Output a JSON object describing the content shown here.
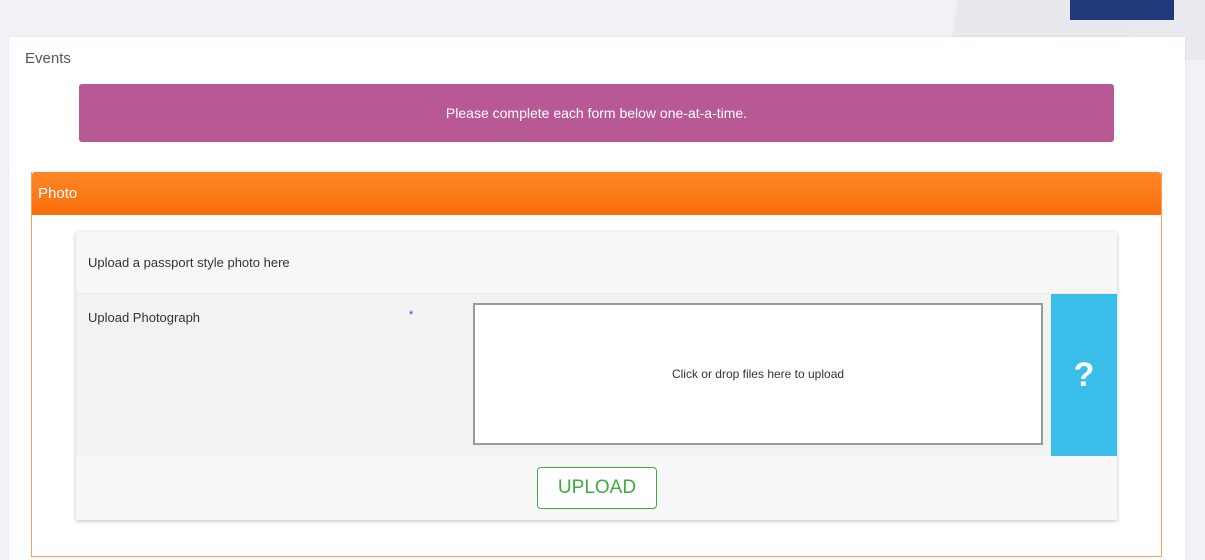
{
  "section": {
    "title": "Events"
  },
  "notice": {
    "text": "Please complete each form below one-at-a-time."
  },
  "panel": {
    "title": "Photo",
    "description": "Upload a passport style photo here",
    "field": {
      "label": "Upload Photograph",
      "required_marker": "*",
      "dropzone_text": "Click or drop files here to upload",
      "help_symbol": "?"
    },
    "upload_label": "UPLOAD"
  },
  "colors": {
    "notice_bg": "#b85995",
    "panel_header": "#fd7411",
    "help_bg": "#3bbde9",
    "upload_green": "#3eaa3e",
    "required_blue": "#1c55c7"
  },
  "icons": {
    "help": "question-icon",
    "required": "asterisk-icon"
  }
}
